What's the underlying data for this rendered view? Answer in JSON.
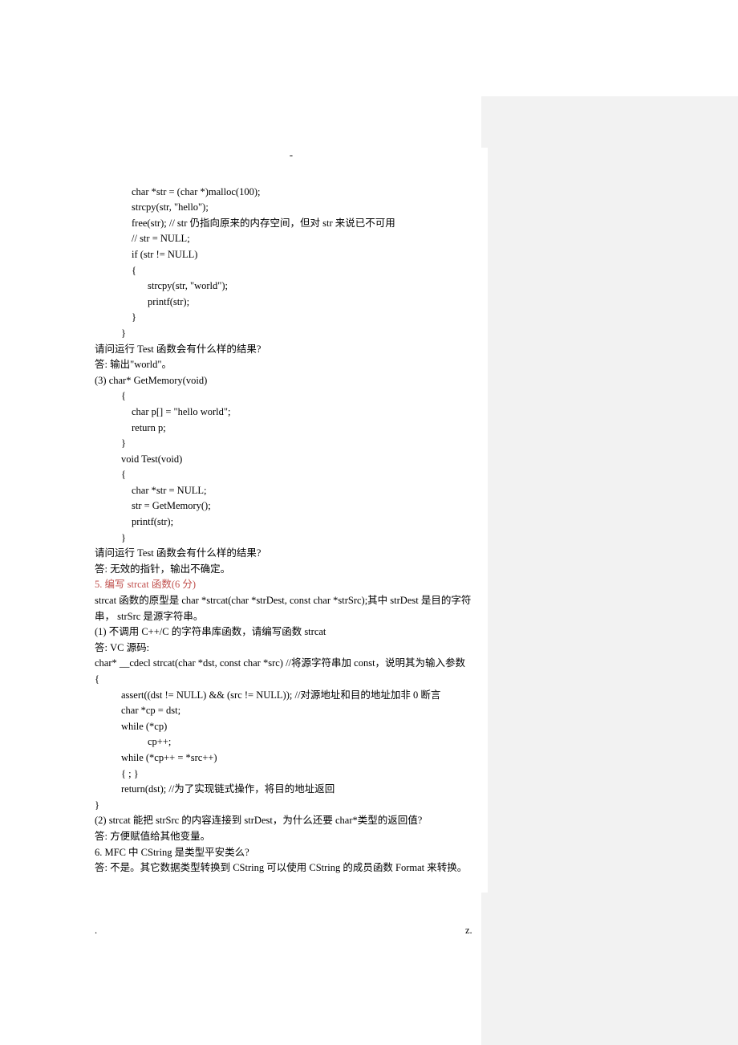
{
  "topMark": "-",
  "code2": {
    "l1": "char *str = (char *)malloc(100);",
    "l2": "strcpy(str, \"hello\");",
    "l3": "free(str);       // str 仍指向原来的内存空间，但对 str 来说已不可用",
    "l4": "// str = NULL;",
    "l5": "if (str != NULL)",
    "l6": "{",
    "l7": "strcpy(str, \"world\");",
    "l8": "printf(str);",
    "l9": "}",
    "l10": "}"
  },
  "q2": "请问运行 Test 函数会有什么样的结果?",
  "a2": "答: 输出\"world\"。",
  "q3head": "(3)    char* GetMemory(void)",
  "code3": {
    "l1": "{",
    "l2": "char p[] = \"hello world\";",
    "l3": "return p;",
    "l4": "}",
    "l5": "void Test(void)",
    "l6": "{",
    "l7": "char *str = NULL;",
    "l8": "str = GetMemory();",
    "l9": "printf(str);",
    "l10": "}"
  },
  "q3": "请问运行 Test 函数会有什么样的结果?",
  "a3": "答: 无效的指针，输出不确定。",
  "s5title": "5. 编写 strcat 函数(6 分)",
  "s5p1": "strcat 函数的原型是 char *strcat(char *strDest, const char *strSrc);其中 strDest 是目的字符串， strSrc 是源字符串。",
  "s5p2": "(1) 不调用 C++/C 的字符串库函数，请编写函数 strcat",
  "s5p3": "答: VC 源码:",
  "code5": {
    "l1": "char* __cdecl strcat(char *dst, const char *src) //将源字符串加 const，说明其为输入参数",
    "l2": "{",
    "l3": "assert((dst != NULL) && (src != NULL));    //对源地址和目的地址加非 0 断言",
    "l4": "char *cp = dst;",
    "l5": "while (*cp)",
    "l6": "cp++;",
    "l7": "while (*cp++ = *src++)",
    "l8": "{    ;    }",
    "l9": "return(dst);    //为了实现链式操作，将目的地址返回",
    "l10": "}"
  },
  "s5q2": "(2) strcat 能把 strSrc 的内容连接到 strDest，为什么还要 char*类型的返回值?",
  "s5a2": "答: 方便赋值给其他变量。",
  "s6q": "6. MFC 中 CString 是类型平安类么?",
  "s6a": "答: 不是。其它数据类型转换到 CString 可以使用 CString 的成员函数 Format 来转换。",
  "footerLeft": ".",
  "footerRight": "z."
}
